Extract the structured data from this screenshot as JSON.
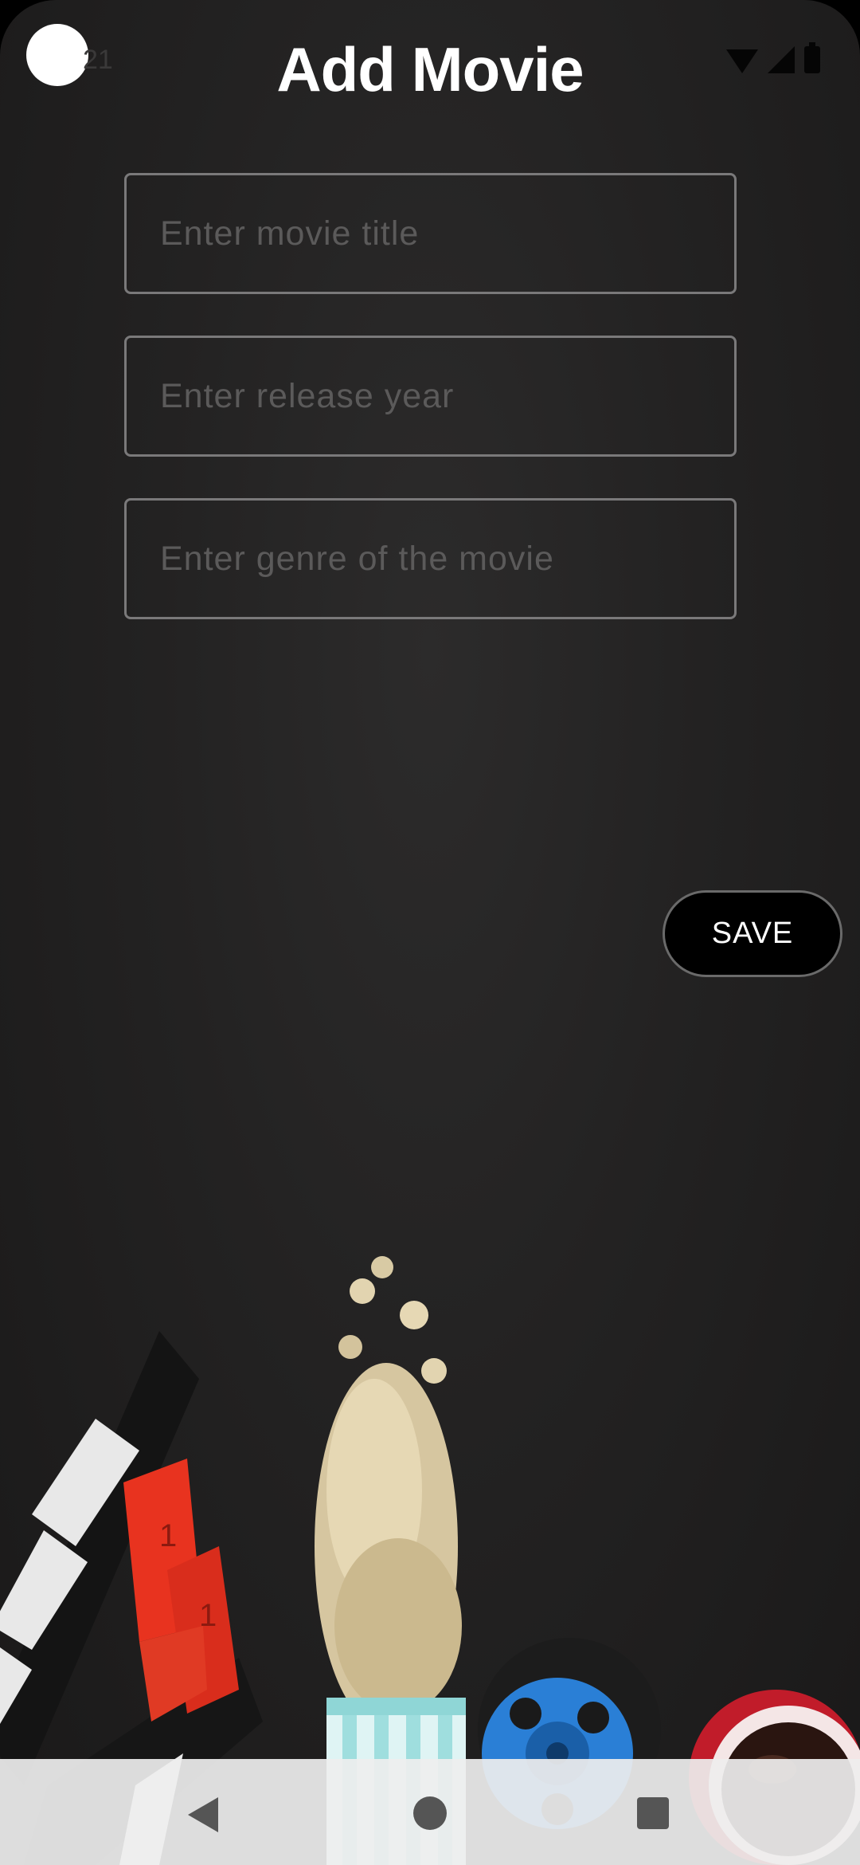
{
  "status_bar": {
    "time": "21",
    "icons": [
      "wifi-icon",
      "signal-icon",
      "battery-icon"
    ]
  },
  "header": {
    "title": "Add Movie"
  },
  "form": {
    "title_placeholder": "Enter movie title",
    "year_placeholder": "Enter release year",
    "genre_placeholder": "Enter genre of the movie",
    "save_label": "SAVE"
  },
  "nav_bar": {
    "icons": [
      "back-icon",
      "home-icon",
      "recents-icon"
    ]
  },
  "colors": {
    "background": "#232222",
    "title": "#ffffff",
    "field_border": "#7a797a",
    "placeholder": "#5b5a5a",
    "button_bg": "#000000",
    "button_text": "#ffffff"
  }
}
